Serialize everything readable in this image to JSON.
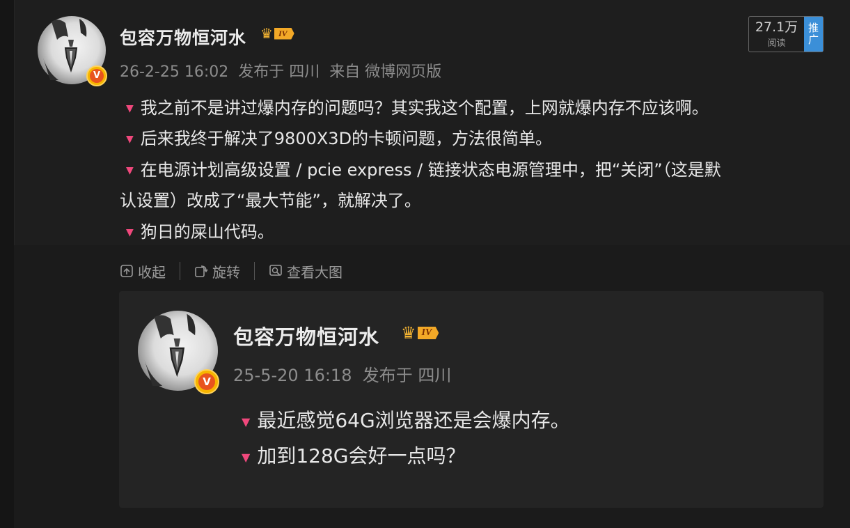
{
  "post": {
    "author": "包容万物恒河水",
    "level": "IV",
    "meta": "26-2-25 16:02  发布于 四川  来自 微博网页版",
    "reads_count": "27.1万",
    "reads_label": "阅读",
    "promo_top": "推",
    "promo_bottom": "广",
    "lines": [
      "我之前不是讲过爆内存的问题吗？其实我这个配置，上网就爆内存不应该啊。",
      "后来我终于解决了9800X3D的卡顿问题，方法很简单。",
      "在电源计划高级设置 / pcie express / 链接状态电源管理中，把“关闭”（这是默",
      "认设置）改成了“最大节能”，就解决了。",
      "狗日的屎山代码。"
    ]
  },
  "actions": {
    "collapse": "收起",
    "rotate": "旋转",
    "view_large": "查看大图"
  },
  "repost": {
    "author": "包容万物恒河水",
    "level": "IV",
    "meta": "25-5-20 16:18  发布于 四川",
    "lines": [
      "最近感觉64G浏览器还是会爆内存。",
      "加到128G会好一点吗？"
    ]
  },
  "badge_letter": "V",
  "colors": {
    "bullet": "#f0487c",
    "promo": "#3b8fd8",
    "badge": "#f7b500"
  }
}
